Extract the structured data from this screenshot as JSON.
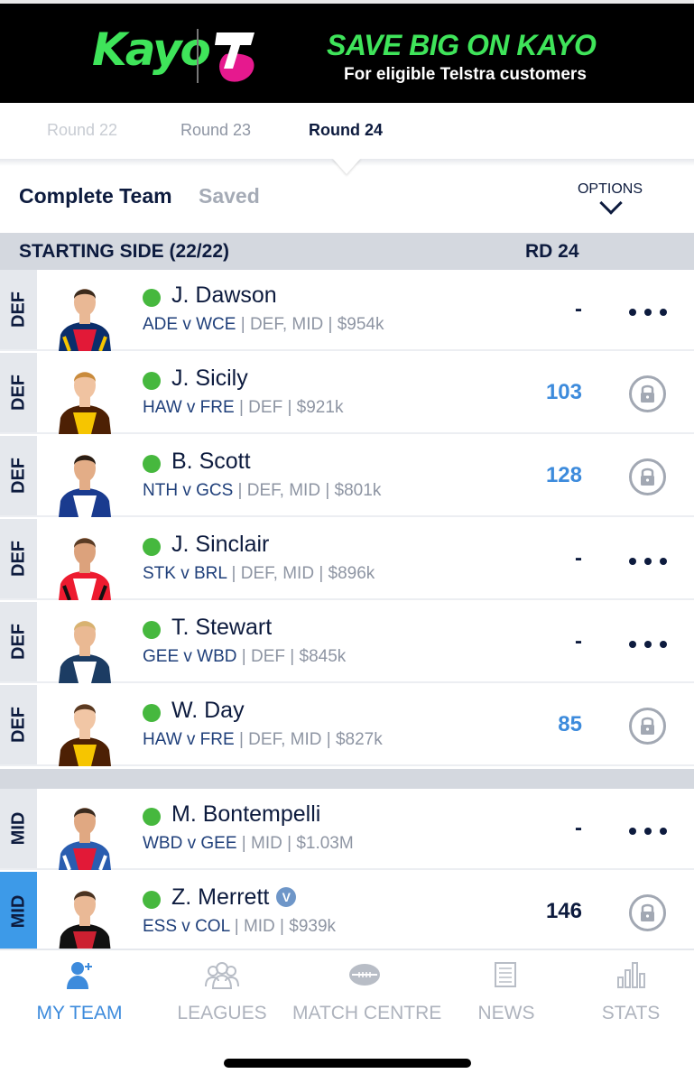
{
  "banner": {
    "brand": "Kayo",
    "headline": "SAVE BIG ON KAYO",
    "subline": "For eligible Telstra customers",
    "kayo_color": "#3fe45a",
    "telstra_color": "#e6198e"
  },
  "round_tabs": [
    "Round 22",
    "Round 23",
    "Round 24"
  ],
  "selected_round": "Round 24",
  "team": {
    "title": "Complete Team",
    "status": "Saved",
    "options_label": "OPTIONS"
  },
  "section": {
    "title": "STARTING SIDE (22/22)",
    "round_label": "RD 24"
  },
  "players": [
    {
      "pos": "DEF",
      "name": "J. Dawson",
      "fixture": "ADE v WCE",
      "meta": " | DEF, MID | $954k",
      "score": "-",
      "action": "more",
      "jersey": "adelaide"
    },
    {
      "pos": "DEF",
      "name": "J. Sicily",
      "fixture": "HAW v FRE",
      "meta": " | DEF | $921k",
      "score": "103",
      "action": "lock",
      "jersey": "hawthorn"
    },
    {
      "pos": "DEF",
      "name": "B. Scott",
      "fixture": "NTH v GCS",
      "meta": " | DEF, MID | $801k",
      "score": "128",
      "action": "lock",
      "jersey": "north"
    },
    {
      "pos": "DEF",
      "name": "J. Sinclair",
      "fixture": "STK v BRL",
      "meta": " | DEF, MID | $896k",
      "score": "-",
      "action": "more",
      "jersey": "stkilda"
    },
    {
      "pos": "DEF",
      "name": "T. Stewart",
      "fixture": "GEE v WBD",
      "meta": " | DEF | $845k",
      "score": "-",
      "action": "more",
      "jersey": "geelong"
    },
    {
      "pos": "DEF",
      "name": "W. Day",
      "fixture": "HAW v FRE",
      "meta": " | DEF, MID | $827k",
      "score": "85",
      "action": "lock",
      "jersey": "hawthorn"
    },
    {
      "pos": "MID",
      "name": "M. Bontempelli",
      "fixture": "WBD v GEE",
      "meta": " | MID | $1.03M",
      "score": "-",
      "action": "more",
      "jersey": "bulldogs"
    },
    {
      "pos": "MID",
      "name": "Z. Merrett",
      "fixture": "ESS v COL",
      "meta": " | MID | $939k",
      "score": "146",
      "action": "lock",
      "jersey": "essendon",
      "badge": "V"
    }
  ],
  "nav": [
    {
      "label": "MY TEAM",
      "icon": "user-icon",
      "active": true
    },
    {
      "label": "LEAGUES",
      "icon": "group-icon",
      "active": false
    },
    {
      "label": "MATCH CENTRE",
      "icon": "football-icon",
      "active": false
    },
    {
      "label": "NEWS",
      "icon": "news-icon",
      "active": false
    },
    {
      "label": "STATS",
      "icon": "stats-icon",
      "active": false
    }
  ],
  "colors": {
    "accent": "#3d8bdc",
    "navy": "#0d1b3e",
    "status_green": "#46b83e",
    "section_grey": "#d4d8df"
  }
}
